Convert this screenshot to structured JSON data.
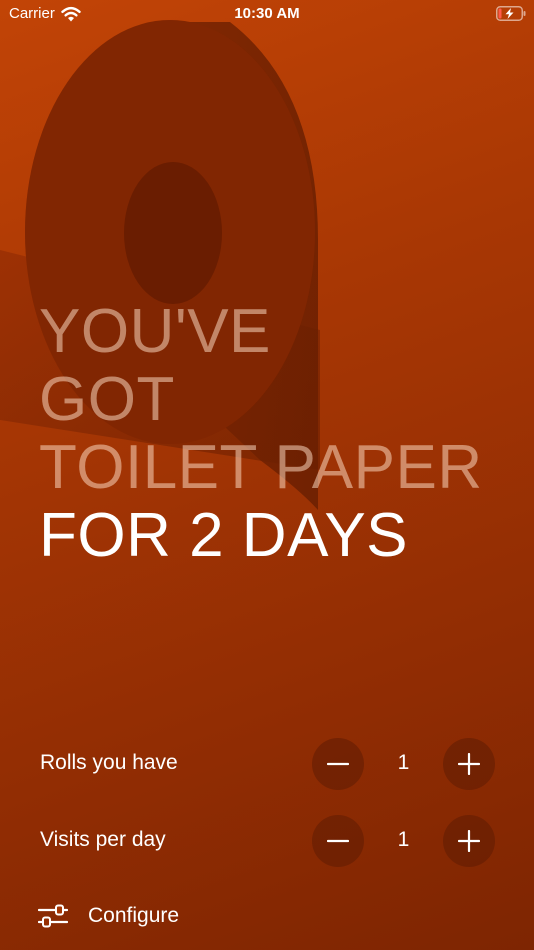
{
  "status_bar": {
    "carrier": "Carrier",
    "time": "10:30 AM"
  },
  "headline": {
    "line1": "YOU'VE",
    "line2": "GOT",
    "line3": "TOILET PAPER",
    "line4": "FOR 2 DAYS"
  },
  "rolls": {
    "label": "Rolls you have",
    "value": "1"
  },
  "visits": {
    "label": "Visits per day",
    "value": "1"
  },
  "configure": {
    "label": "Configure"
  },
  "colors": {
    "background_top": "#c24406",
    "background_bottom": "#7e2502",
    "roll_dark": "#6f1f02",
    "text_dim": "#f0b89a",
    "text_bright": "#ffffff",
    "battery_accent": "#ff5a4a"
  },
  "icons": {
    "wifi": "wifi-icon",
    "battery": "battery-charging-icon",
    "minus": "minus-icon",
    "plus": "plus-icon",
    "configure": "sliders-icon"
  }
}
